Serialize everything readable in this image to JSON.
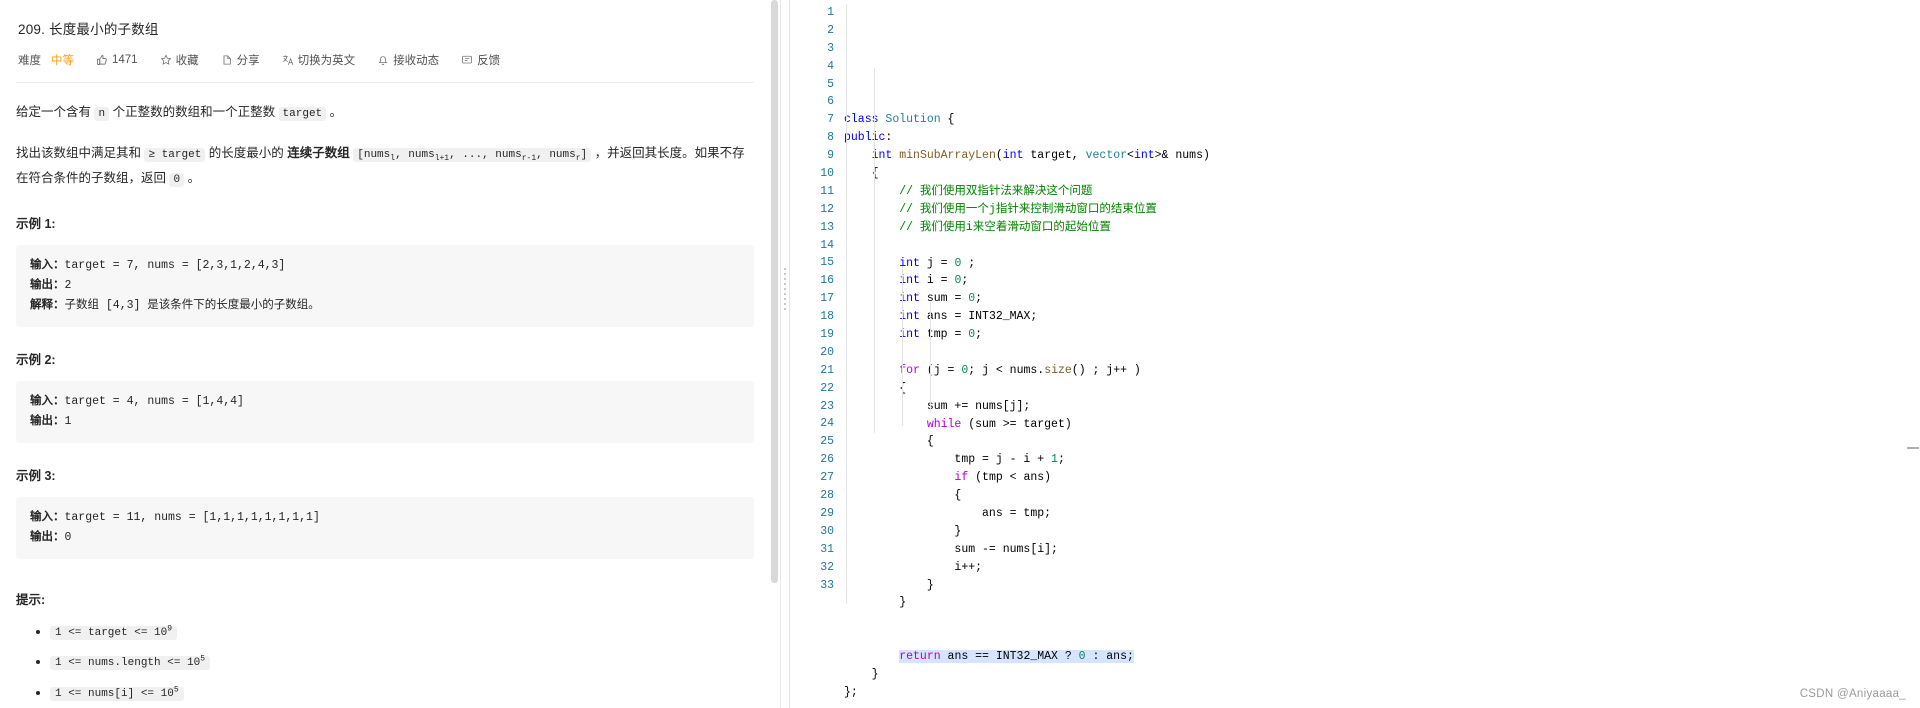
{
  "problem": {
    "title": "209. 长度最小的子数组",
    "meta": {
      "difficulty_label": "难度",
      "difficulty_value": "中等",
      "difficulty_color": "#ffa116",
      "likes": "1471",
      "favorite": "收藏",
      "share": "分享",
      "translate": "切换为英文",
      "subscribe": "接收动态",
      "feedback": "反馈"
    },
    "paragraphs": [
      {
        "segments": [
          {
            "t": "text",
            "v": "给定一个含有 "
          },
          {
            "t": "code",
            "v": "n"
          },
          {
            "t": "text",
            "v": " 个正整数的数组和一个正整数 "
          },
          {
            "t": "code",
            "v": "target"
          },
          {
            "t": "text",
            "v": " 。"
          }
        ]
      },
      {
        "segments": [
          {
            "t": "text",
            "v": "找出该数组中满足其和 "
          },
          {
            "t": "code",
            "v": "≥ target"
          },
          {
            "t": "text",
            "v": " 的长度最小的 "
          },
          {
            "t": "bold",
            "v": "连续子数组"
          },
          {
            "t": "text",
            "v": " "
          },
          {
            "t": "code_sub",
            "v": "[nums<sub>l</sub>, nums<sub>l+1</sub>, ..., nums<sub>r-1</sub>, nums<sub>r</sub>]"
          },
          {
            "t": "text",
            "v": " ，并返回其长度。如果不存在符合条件的子数组，返回 "
          },
          {
            "t": "code",
            "v": "0"
          },
          {
            "t": "text",
            "v": " 。"
          }
        ]
      }
    ],
    "examples": [
      {
        "heading": "示例 1:",
        "lines": [
          {
            "label": "输入：",
            "value": "target = 7, nums = [2,3,1,2,4,3]"
          },
          {
            "label": "输出：",
            "value": "2"
          },
          {
            "label": "解释：",
            "value": "子数组 [4,3] 是该条件下的长度最小的子数组。"
          }
        ]
      },
      {
        "heading": "示例 2:",
        "lines": [
          {
            "label": "输入：",
            "value": "target = 4, nums = [1,4,4]"
          },
          {
            "label": "输出：",
            "value": "1"
          }
        ]
      },
      {
        "heading": "示例 3:",
        "lines": [
          {
            "label": "输入：",
            "value": "target = 11, nums = [1,1,1,1,1,1,1,1]"
          },
          {
            "label": "输出：",
            "value": "0"
          }
        ]
      }
    ],
    "hints_heading": "提示:",
    "hints": [
      "1 <= target <= 10<sup>9</sup>",
      "1 <= nums.length <= 10<sup>5</sup>",
      "1 <= nums[i] <= 10<sup>5</sup>"
    ]
  },
  "editor": {
    "first_line": 1,
    "last_line": 33,
    "highlight_line": 31,
    "lines": [
      {
        "n": 1,
        "html": "<span class=\"tok-kw\">class</span> <span class=\"tok-type\">Solution</span> {"
      },
      {
        "n": 2,
        "html": "<span class=\"tok-kw\">public</span>:"
      },
      {
        "n": 3,
        "html": "    <span class=\"tok-kw\">int</span> <span class=\"tok-fn\">minSubArrayLen</span>(<span class=\"tok-kw\">int</span> target, <span class=\"tok-type\">vector</span>&lt;<span class=\"tok-kw\">int</span>&gt;&amp; nums)"
      },
      {
        "n": 4,
        "html": "    {"
      },
      {
        "n": 5,
        "html": "        <span class=\"tok-cm\">// 我们使用双指针法来解决这个问题</span>"
      },
      {
        "n": 6,
        "html": "        <span class=\"tok-cm\">// 我们使用一个j指针来控制滑动窗口的结束位置</span>"
      },
      {
        "n": 7,
        "html": "        <span class=\"tok-cm\">// 我们使用i来空着滑动窗口的起始位置</span>"
      },
      {
        "n": 8,
        "html": ""
      },
      {
        "n": 9,
        "html": "        <span class=\"tok-kw\">int</span> j = <span class=\"tok-num\">0</span> ;"
      },
      {
        "n": 10,
        "html": "        <span class=\"tok-kw\">int</span> i = <span class=\"tok-num\">0</span>;"
      },
      {
        "n": 11,
        "html": "        <span class=\"tok-kw\">int</span> sum = <span class=\"tok-num\">0</span>;"
      },
      {
        "n": 12,
        "html": "        <span class=\"tok-kw\">int</span> ans = INT32_MAX;"
      },
      {
        "n": 13,
        "html": "        <span class=\"tok-kw\">int</span> tmp = <span class=\"tok-num\">0</span>;"
      },
      {
        "n": 14,
        "html": ""
      },
      {
        "n": 15,
        "html": "        <span class=\"tok-ctl\">for</span> (j = <span class=\"tok-num\">0</span>; j &lt; nums.<span class=\"tok-fn\">size</span>() ; j++ )"
      },
      {
        "n": 16,
        "html": "        {"
      },
      {
        "n": 17,
        "html": "            sum += nums[j];"
      },
      {
        "n": 18,
        "html": "            <span class=\"tok-ctl\">while</span> (sum &gt;= target)"
      },
      {
        "n": 19,
        "html": "            {"
      },
      {
        "n": 20,
        "html": "                tmp = j - i + <span class=\"tok-num\">1</span>;"
      },
      {
        "n": 21,
        "html": "                <span class=\"tok-ctl\">if</span> (tmp &lt; ans)"
      },
      {
        "n": 22,
        "html": "                {"
      },
      {
        "n": 23,
        "html": "                    ans = tmp;"
      },
      {
        "n": 24,
        "html": "                }"
      },
      {
        "n": 25,
        "html": "                sum -= nums[i];"
      },
      {
        "n": 26,
        "html": "                i++;"
      },
      {
        "n": 27,
        "html": "            }"
      },
      {
        "n": 28,
        "html": "        }"
      },
      {
        "n": 29,
        "html": ""
      },
      {
        "n": 30,
        "html": ""
      },
      {
        "n": 31,
        "html": "        <span class=\"hlbg\"><span class=\"tok-ctl\">return</span> ans == INT32_MAX ? <span class=\"tok-num\">0</span> : ans;</span>"
      },
      {
        "n": 32,
        "html": "    }"
      },
      {
        "n": 33,
        "html": "};"
      }
    ]
  },
  "watermark": "CSDN @Aniyaaaa_"
}
